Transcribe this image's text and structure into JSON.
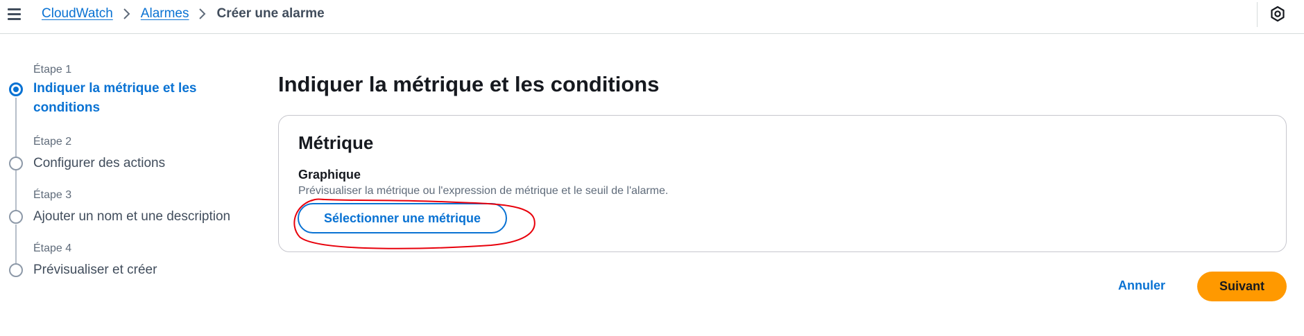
{
  "header": {
    "menu_icon": "hamburger-menu-icon",
    "breadcrumbs": [
      {
        "label": "CloudWatch"
      },
      {
        "label": "Alarmes"
      },
      {
        "label": "Créer une alarme"
      }
    ],
    "separator_icon": "chevron-right-icon",
    "settings_icon": "settings-hexagon-icon"
  },
  "wizard": {
    "steps": [
      {
        "number": "Étape 1",
        "title": "Indiquer la métrique et les conditions",
        "active": true
      },
      {
        "number": "Étape 2",
        "title": "Configurer des actions",
        "active": false
      },
      {
        "number": "Étape 3",
        "title": "Ajouter un nom et une description",
        "active": false
      },
      {
        "number": "Étape 4",
        "title": "Prévisualiser et créer",
        "active": false
      }
    ]
  },
  "main": {
    "title": "Indiquer la métrique et les conditions",
    "metric_section": {
      "title": "Métrique",
      "field_label": "Graphique",
      "field_description": "Prévisualiser la métrique ou l'expression de métrique et le seuil de l'alarme.",
      "select_button_label": "Sélectionner une métrique"
    }
  },
  "actions": {
    "cancel_label": "Annuler",
    "next_label": "Suivant"
  },
  "colors": {
    "accent": "#0972d3",
    "primary_button": "#ff9900",
    "annotation": "#e8000b"
  }
}
